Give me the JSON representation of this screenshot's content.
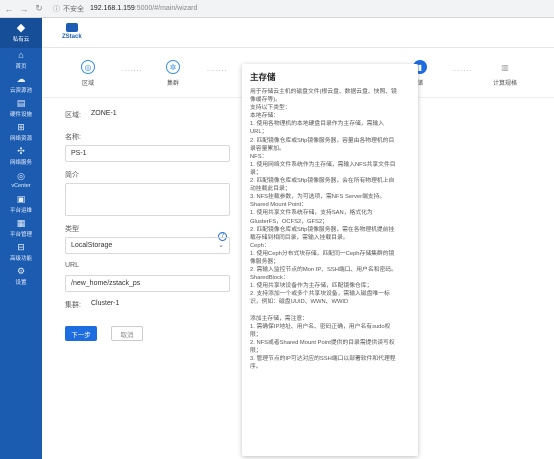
{
  "browser": {
    "security_label": "不安全",
    "url_host": "192.168.1.159",
    "url_path": ":5000/#/main/wizard"
  },
  "sidebar": {
    "logo_label": "私有云",
    "items": [
      {
        "label": "首页",
        "icon": "home-icon"
      },
      {
        "label": "云资源池",
        "icon": "cloud-icon"
      },
      {
        "label": "硬件设施",
        "icon": "server-icon"
      },
      {
        "label": "网络资源",
        "icon": "network-icon"
      },
      {
        "label": "网络服务",
        "icon": "network-service-icon"
      },
      {
        "label": "vCenter",
        "icon": "vcenter-icon"
      },
      {
        "label": "平台运维",
        "icon": "ops-icon"
      },
      {
        "label": "平台管理",
        "icon": "admin-icon"
      },
      {
        "label": "高级功能",
        "icon": "advanced-icon"
      },
      {
        "label": "设置",
        "icon": "settings-icon"
      }
    ]
  },
  "header": {
    "brand": "ZStack"
  },
  "steps": [
    {
      "label": "区域",
      "state": "done"
    },
    {
      "label": "集群",
      "state": "done"
    },
    {
      "label": "",
      "state": "idle"
    },
    {
      "label": "",
      "state": "idle"
    },
    {
      "label": "储",
      "state": "active"
    },
    {
      "label": "计算规格",
      "state": "idle"
    }
  ],
  "form": {
    "zone_key": "区域:",
    "zone_value": "ZONE-1",
    "name_label": "名称:",
    "name_value": "PS-1",
    "desc_label": "简介",
    "type_label": "类型",
    "type_value": "LocalStorage",
    "url_label": "URL",
    "url_value": "/new_home/zstack_ps",
    "cluster_key": "集群:",
    "cluster_value": "Cluster-1",
    "next_label": "下一步",
    "cancel_label": "取消"
  },
  "tooltip": {
    "title": "主存储",
    "lines": [
      "用于存储云主机的磁盘文件(根云盘、数据云盘、快照、镜",
      "像缓存等)。",
      "支持以下类型：",
      "本地存储：",
      "1. 使用各物理机的本地硬盘目录作为主存储，需输入",
      "URL；",
      "2. 匹配镜像仓库或Sftp镜像服务器，容量由各物理机的目",
      "录容量累加。",
      "NFS：",
      "1. 使用网络文件系统作为主存储，需输入NFS共享文件目",
      "录；",
      "2. 匹配镜像仓库或Sftp镜像服务器，会在所有物理机上自",
      "动挂载此目录；",
      "3. NFS挂载参数，为可选项，需NFS Server端支持。",
      "Shared Mount Point：",
      "1. 使用共享文件系统存储，支持SAN，格式化为",
      "GlusterFS，OCFS2，GFS2；",
      "2. 匹配镜像仓库或Sftp镜像服务器，需在各物理机提前挂",
      "载存储到相同目录，需输入挂载目录。",
      "Ceph：",
      "1. 使用Ceph分布式块存储，匹配同一Ceph存储集群的镜",
      "像服务器；",
      "2. 需输入监控节点的Mon IP、SSH端口、用户名和密码。",
      "SharedBlock：",
      "1. 使用共享块设备作为主存储，匹配镜像仓库；",
      "2. 支持添加一个或多个共享块设备，需输入磁盘唯一标",
      "识，例如：磁盘UUID、WWN、WWID",
      "",
      "添加主存储，需注意：",
      "1. 需确保IP地址、用户名、密码正确，用户名有sudo权",
      "限；",
      "2. NFS或者Shared Mount Point提供的目录需提供读写权",
      "限；",
      "3. 管理节点的IP可达对应的SSH端口以部署软件和代理程",
      "序。"
    ]
  }
}
